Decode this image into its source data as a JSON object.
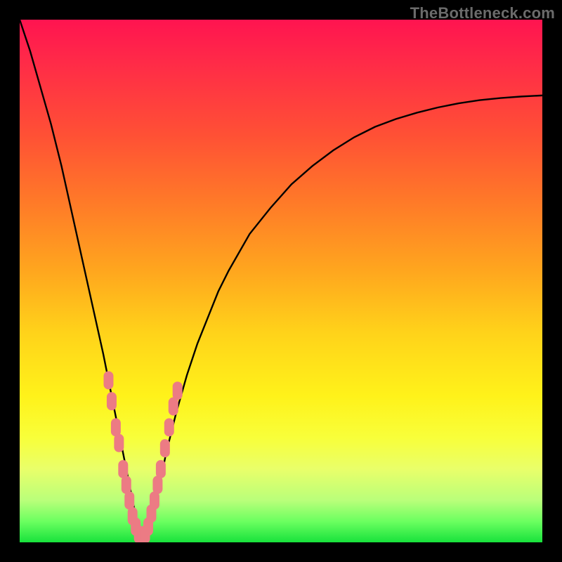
{
  "watermark": "TheBottleneck.com",
  "colors": {
    "frame": "#000000",
    "curve": "#000000",
    "marker": "#ec7b84",
    "gradient_stops": [
      "#ff1450",
      "#ff2a48",
      "#ff5035",
      "#ff7a28",
      "#ffa61e",
      "#ffd31a",
      "#fff21a",
      "#f8ff3a",
      "#e9ff6a",
      "#b9ff7a",
      "#6bff60",
      "#18e23c"
    ]
  },
  "chart_data": {
    "type": "line",
    "title": "",
    "xlabel": "",
    "ylabel": "",
    "xlim": [
      0,
      100
    ],
    "ylim": [
      0,
      100
    ],
    "x_bottom": 23,
    "series": [
      {
        "name": "v-curve",
        "x": [
          0,
          2,
          4,
          6,
          8,
          10,
          12,
          14,
          16,
          17,
          18,
          19,
          20,
          21,
          22,
          23,
          24,
          25,
          26,
          27,
          28,
          30,
          32,
          34,
          36,
          38,
          40,
          44,
          48,
          52,
          56,
          60,
          64,
          68,
          72,
          76,
          80,
          84,
          88,
          92,
          96,
          100
        ],
        "y": [
          100,
          94,
          87,
          80,
          72,
          63,
          54,
          45,
          36,
          31,
          26,
          21,
          16,
          11,
          6,
          1,
          1,
          3,
          7,
          12,
          17,
          25,
          32,
          38,
          43,
          48,
          52,
          59,
          64,
          68.5,
          72,
          75,
          77.5,
          79.5,
          81,
          82.2,
          83.2,
          84,
          84.6,
          85,
          85.3,
          85.5
        ]
      }
    ],
    "markers": {
      "name": "highlighted-points",
      "shape": "rounded-rect",
      "points": [
        {
          "x": 17.0,
          "y": 31
        },
        {
          "x": 17.6,
          "y": 27
        },
        {
          "x": 18.4,
          "y": 22
        },
        {
          "x": 19.0,
          "y": 19
        },
        {
          "x": 19.8,
          "y": 14
        },
        {
          "x": 20.4,
          "y": 11
        },
        {
          "x": 21.0,
          "y": 8
        },
        {
          "x": 21.6,
          "y": 5
        },
        {
          "x": 22.2,
          "y": 3
        },
        {
          "x": 22.8,
          "y": 1.5
        },
        {
          "x": 23.4,
          "y": 1
        },
        {
          "x": 24.0,
          "y": 1.5
        },
        {
          "x": 24.6,
          "y": 3
        },
        {
          "x": 25.2,
          "y": 5.5
        },
        {
          "x": 25.8,
          "y": 8
        },
        {
          "x": 26.4,
          "y": 11
        },
        {
          "x": 27.0,
          "y": 14
        },
        {
          "x": 27.8,
          "y": 18
        },
        {
          "x": 28.6,
          "y": 22
        },
        {
          "x": 29.4,
          "y": 26
        },
        {
          "x": 30.2,
          "y": 29
        }
      ]
    }
  }
}
